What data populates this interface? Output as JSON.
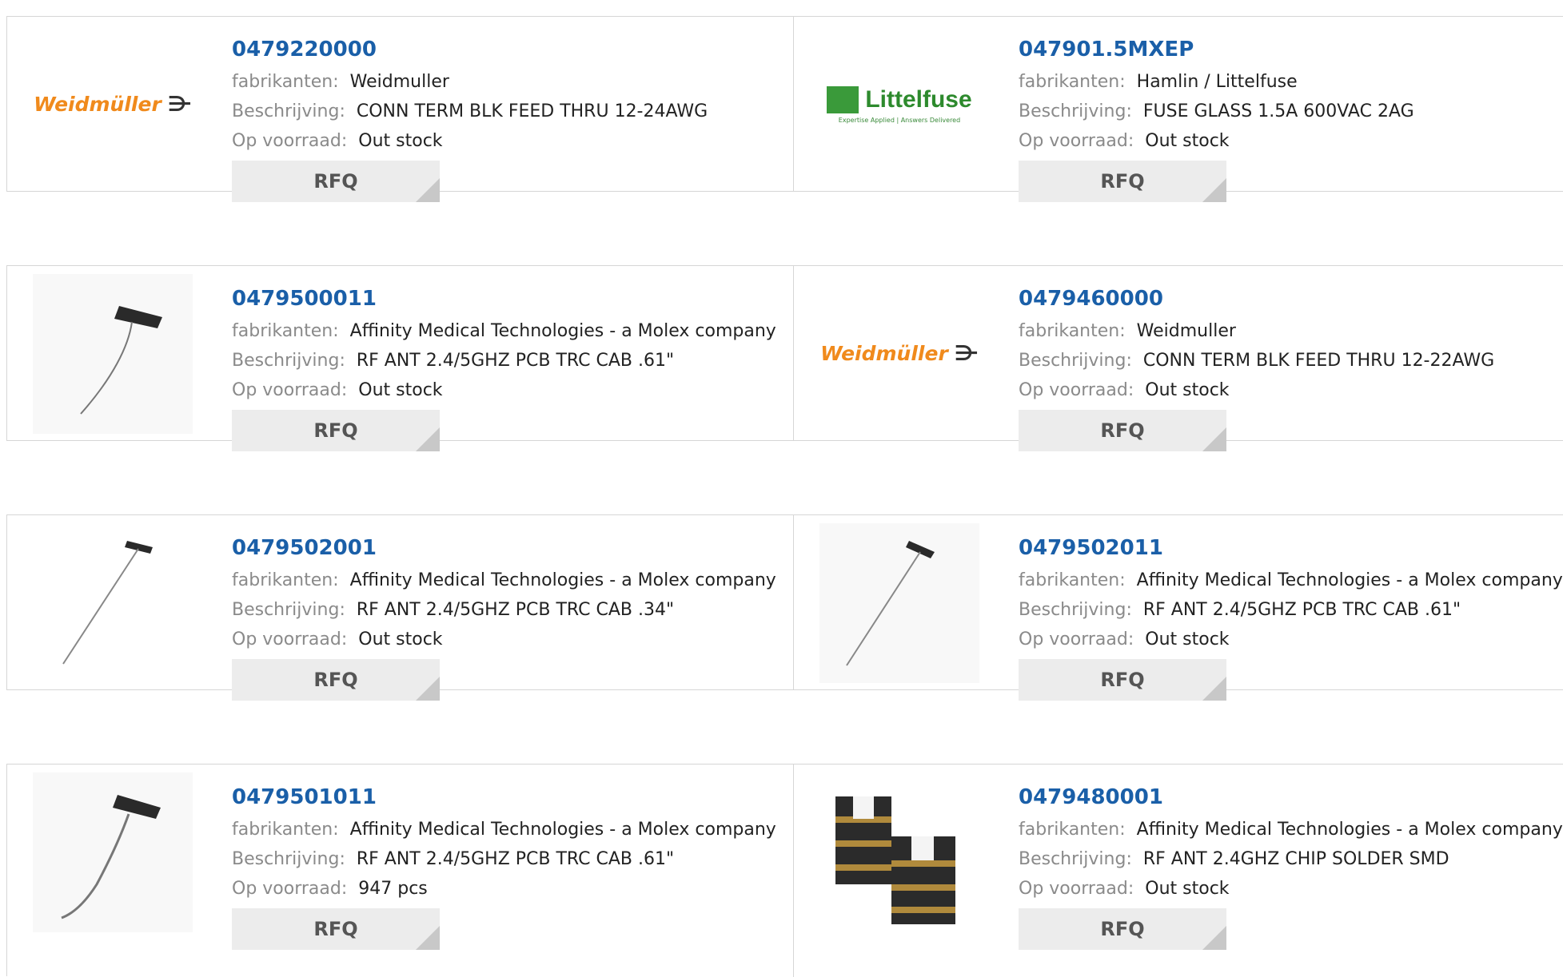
{
  "labels": {
    "manufacturer": "fabrikanten:",
    "description": "Beschrijving:",
    "stock": "Op voorraad:",
    "rfq": "RFQ"
  },
  "logos": {
    "weidmuller": "Weidmüller",
    "littelfuse": "Littelfuse",
    "littelfuse_tagline": "Expertise Applied | Answers Delivered"
  },
  "colors": {
    "part_link": "#1a5fa8",
    "label_gray": "#8a8a8a",
    "weidmuller_orange": "#f08a1c",
    "littelfuse_green": "#2d8a2d"
  },
  "products": [
    {
      "part": "0479220000",
      "manufacturer": "Weidmuller",
      "description": "CONN TERM BLK FEED THRU 12-24AWG",
      "stock": "Out stock",
      "image": "weidmuller-logo"
    },
    {
      "part": "047901.5MXEP",
      "manufacturer": "Hamlin / Littelfuse",
      "description": "FUSE GLASS 1.5A 600VAC 2AG",
      "stock": "Out stock",
      "image": "littelfuse-logo"
    },
    {
      "part": "0479500011",
      "manufacturer": "Affinity Medical Technologies - a Molex company",
      "description": "RF ANT 2.4/5GHZ PCB TRC CAB .61\"",
      "stock": "Out stock",
      "image": "antenna-short"
    },
    {
      "part": "0479460000",
      "manufacturer": "Weidmuller",
      "description": "CONN TERM BLK FEED THRU 12-22AWG",
      "stock": "Out stock",
      "image": "weidmuller-logo"
    },
    {
      "part": "0479502001",
      "manufacturer": "Affinity Medical Technologies - a Molex company",
      "description": "RF ANT 2.4/5GHZ PCB TRC CAB .34\"",
      "stock": "Out stock",
      "image": "antenna-long"
    },
    {
      "part": "0479502011",
      "manufacturer": "Affinity Medical Technologies - a Molex company",
      "description": "RF ANT 2.4/5GHZ PCB TRC CAB .61\"",
      "stock": "Out stock",
      "image": "antenna-long"
    },
    {
      "part": "0479501011",
      "manufacturer": "Affinity Medical Technologies - a Molex company",
      "description": "RF ANT 2.4/5GHZ PCB TRC CAB .61\"",
      "stock": "947 pcs",
      "image": "antenna-curved"
    },
    {
      "part": "0479480001",
      "manufacturer": "Affinity Medical Technologies - a Molex company",
      "description": "RF ANT 2.4GHZ CHIP SOLDER SMD",
      "stock": "Out stock",
      "image": "chip-antenna"
    }
  ]
}
